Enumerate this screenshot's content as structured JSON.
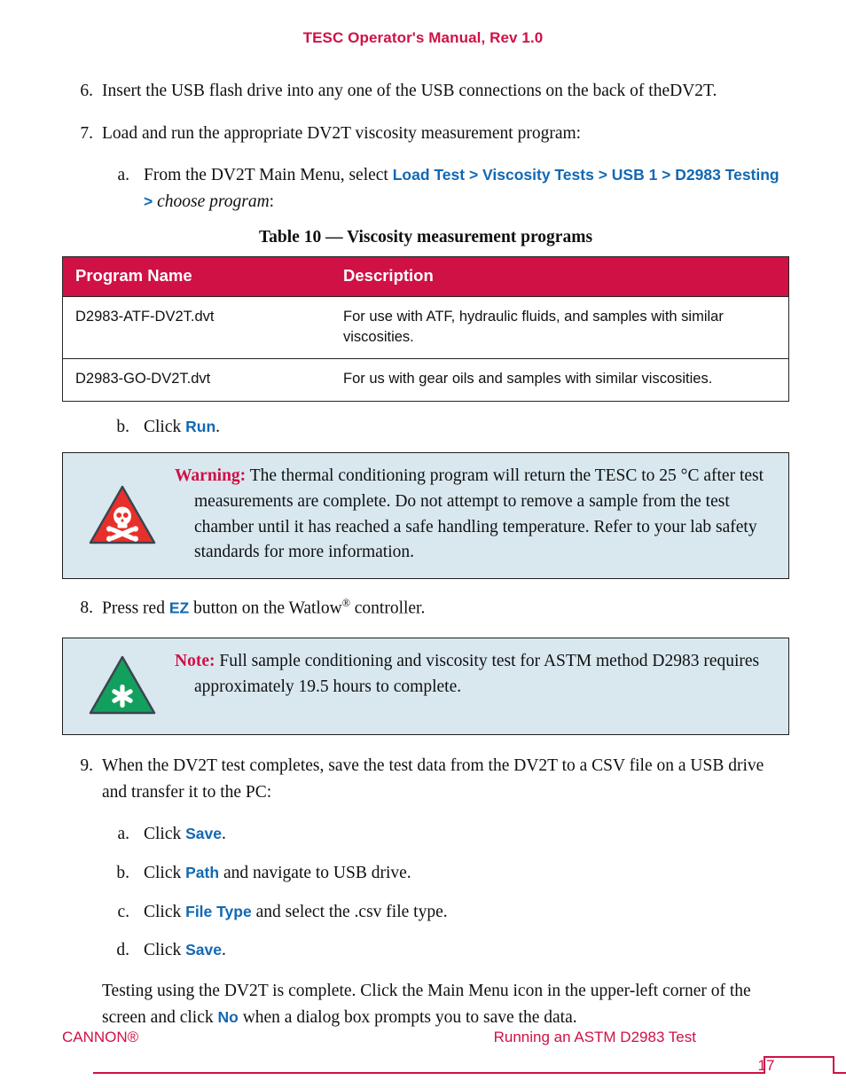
{
  "header": {
    "title": "TESC Operator's Manual, Rev 1.0",
    "color": "#cf1146"
  },
  "colors": {
    "accent_crimson": "#cf1146",
    "link_blue": "#1268b3",
    "callout_bg": "#d9e8ef",
    "warning_red": "#e8302a",
    "note_green": "#12a05e"
  },
  "steps": {
    "s6": {
      "marker": "6.",
      "text": "Insert the USB flash drive into any one of the USB connections on the back of theDV2T."
    },
    "s7": {
      "marker": "7.",
      "text": "Load and run the appropriate DV2T viscosity measurement program:"
    },
    "s7a": {
      "marker": "a.",
      "lead": "From the DV2T Main Menu, select ",
      "ui_path": "Load Test > Viscosity Tests > USB 1 > D2983 Testing >",
      "italic_tail": " choose program",
      "tail": ":"
    },
    "s7b": {
      "marker": "b.",
      "lead": "Click ",
      "ui": "Run",
      "tail": "."
    },
    "s8": {
      "marker": "8.",
      "lead": "Press red ",
      "ui": "EZ",
      "mid": " button on the Watlow",
      "sup": "®",
      "tail": " controller."
    },
    "s9": {
      "marker": "9.",
      "text": "When the DV2T test completes, save the test data from the DV2T to a CSV file on a USB drive and transfer it to the PC:"
    },
    "s9a": {
      "marker": "a.",
      "lead": "Click ",
      "ui": "Save",
      "tail": "."
    },
    "s9b": {
      "marker": "b.",
      "lead": "Click ",
      "ui": "Path",
      "tail": " and navigate to USB drive."
    },
    "s9c": {
      "marker": "c.",
      "lead": "Click ",
      "ui": "File Type",
      "tail": " and select the .csv file type."
    },
    "s9d": {
      "marker": "d.",
      "lead": "Click ",
      "ui": "Save",
      "tail": "."
    },
    "closing": {
      "lead": "Testing using the DV2T is complete. Click the Main Menu icon in the upper-left corner of the screen and click ",
      "ui": "No",
      "tail": " when a dialog box prompts you to save the data."
    }
  },
  "table": {
    "caption": "Table 10 — Viscosity measurement programs",
    "columns": [
      "Program Name",
      "Description"
    ],
    "rows": [
      {
        "name": "D2983-ATF-DV2T.dvt",
        "description": "For use with ATF, hydraulic fluids, and samples with similar viscosities."
      },
      {
        "name": "D2983-GO-DV2T.dvt",
        "description": "For us with gear oils and samples with similar viscosities."
      }
    ]
  },
  "callouts": {
    "warning": {
      "label": "Warning:",
      "icon": "skull-crossbones-warning-triangle",
      "text": "The thermal conditioning program will return the TESC to 25 °C after test measurements are complete. Do not attempt to remove a sample from the test chamber until it has reached a safe handling temperature. Refer to your lab safety standards for more information."
    },
    "note": {
      "label": "Note:",
      "icon": "asterisk-note-triangle",
      "text": "Full sample conditioning and viscosity test for ASTM method D2983 requires approximately 19.5 hours to complete."
    }
  },
  "footer": {
    "left": "CANNON®",
    "right": "Running an ASTM D2983 Test",
    "page_number": "17"
  }
}
